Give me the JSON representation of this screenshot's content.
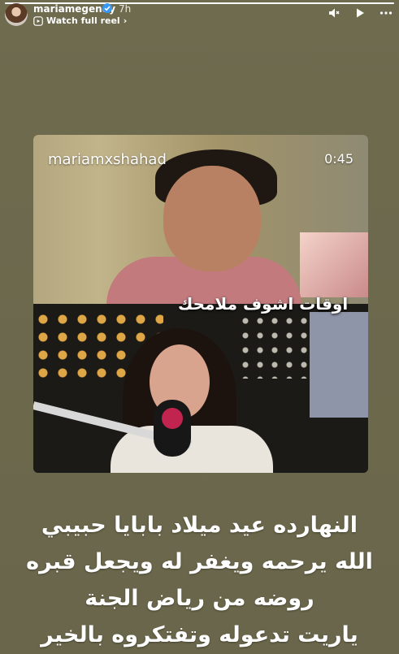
{
  "header": {
    "username": "mariamegendy",
    "time": "7h",
    "reel_link": "Watch full reel",
    "progress": 1.0,
    "icons": [
      "sound-icon",
      "play-icon",
      "more-icon"
    ]
  },
  "media": {
    "overlay_user": "mariamxshahad",
    "timer": "0:45",
    "lyric": "اوقات اشوف ملامحك"
  },
  "caption": {
    "lines": [
      "النهارده عيد ميلاد بابايا حبيبي",
      "الله يرحمه ويغفر له ويجعل قبره",
      "روضه من رياض الجنة",
      "ياريت تدعوله وتفتكروه بالخير"
    ]
  },
  "colors": {
    "background": "#6f6b4f",
    "verified": "#3897f0",
    "text": "#ffffff"
  }
}
